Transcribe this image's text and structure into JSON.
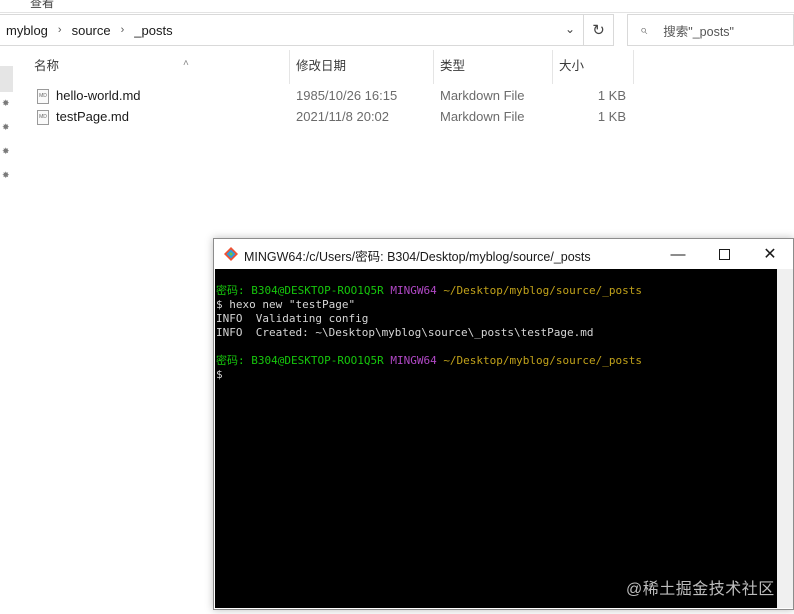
{
  "explorer": {
    "ribbon_partial": "查看",
    "breadcrumb": [
      "myblog",
      "source",
      "_posts"
    ],
    "search_placeholder": "搜索\"_posts\"",
    "columns": {
      "name": "名称",
      "date": "修改日期",
      "type": "类型",
      "size": "大小"
    },
    "files": [
      {
        "name": "hello-world.md",
        "date": "1985/10/26 16:15",
        "type": "Markdown File",
        "size": "1 KB"
      },
      {
        "name": "testPage.md",
        "date": "2021/11/8 20:02",
        "type": "Markdown File",
        "size": "1 KB"
      }
    ],
    "icons": {
      "breadcrumb_sep": "chevron-right-icon",
      "dropdown": "chevron-down-icon",
      "refresh": "refresh-icon",
      "search": "search-icon",
      "pin": "pin-icon",
      "file": "markdown-file-icon"
    }
  },
  "terminal": {
    "title": "MINGW64:/c/Users/密码: B304/Desktop/myblog/source/_posts",
    "lines": [
      {
        "user": "密码: B304@DESKTOP-ROO1Q5R",
        "host": "MINGW64",
        "path": "~/Desktop/myblog/source/_posts"
      },
      {
        "text": "$ hexo new \"testPage\""
      },
      {
        "text": "INFO  Validating config"
      },
      {
        "text": "INFO  Created: ~\\Desktop\\myblog\\source\\_posts\\testPage.md"
      },
      {
        "text": ""
      },
      {
        "user": "密码: B304@DESKTOP-ROO1Q5R",
        "host": "MINGW64",
        "path": "~/Desktop/myblog/source/_posts"
      },
      {
        "text": "$"
      }
    ],
    "colors": {
      "background": "#000000",
      "user": "#16c60c",
      "host": "#b148c6",
      "path": "#c1a21a",
      "text": "#d6d6d6"
    }
  },
  "watermark": "@稀土掘金技术社区"
}
